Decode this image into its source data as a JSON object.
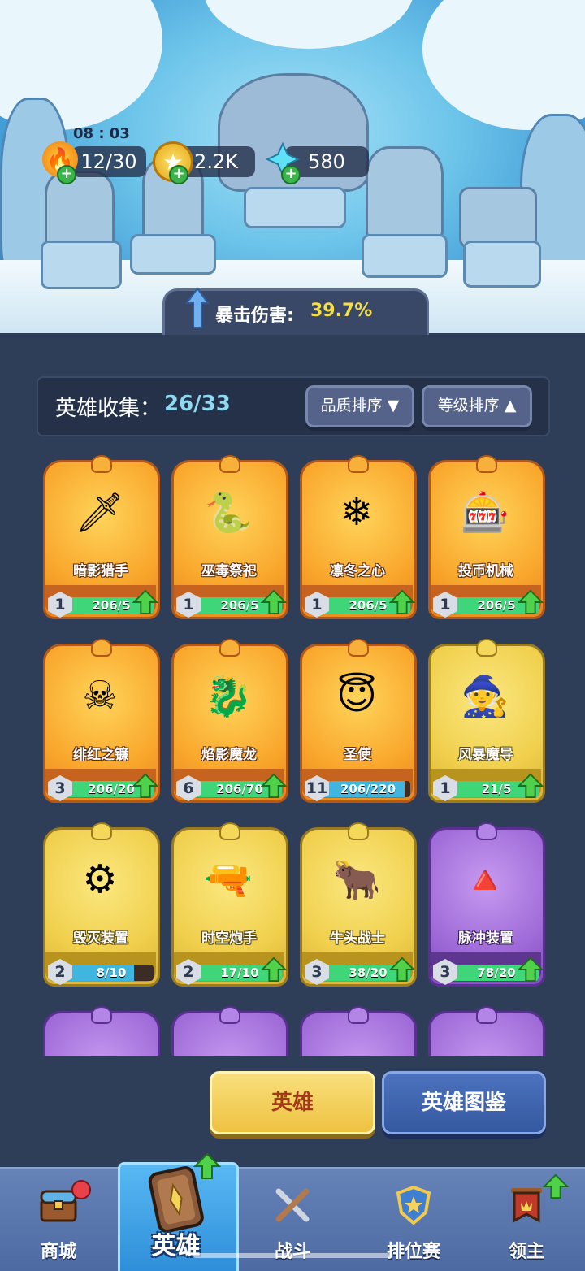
{
  "status": {
    "time": "08 : 03"
  },
  "resources": [
    {
      "name": "energy",
      "icon": "fire-icon",
      "value": "12/30"
    },
    {
      "name": "gold",
      "icon": "star-coin-icon",
      "value": "2.2K"
    },
    {
      "name": "diamond",
      "icon": "crystal-icon",
      "value": "580"
    }
  ],
  "buff": {
    "label": "暴击伤害:",
    "value": "39.7%"
  },
  "collection": {
    "label": "英雄收集：",
    "count": "26/33"
  },
  "sort": {
    "quality": "品质排序 ▼",
    "level": "等级排序 ▲"
  },
  "heroes": [
    {
      "name": "暗影猎手",
      "level": "1",
      "progress": "206/5",
      "fill": 1.0,
      "rarity": "orange",
      "icon": "hooded-hunter-icon",
      "upgradable": true
    },
    {
      "name": "巫毒祭祀",
      "level": "1",
      "progress": "206/5",
      "fill": 1.0,
      "rarity": "orange",
      "icon": "voodoo-priest-icon",
      "upgradable": true
    },
    {
      "name": "凛冬之心",
      "level": "1",
      "progress": "206/5",
      "fill": 1.0,
      "rarity": "orange",
      "icon": "ice-queen-icon",
      "upgradable": true
    },
    {
      "name": "投币机械",
      "level": "1",
      "progress": "206/5",
      "fill": 1.0,
      "rarity": "orange",
      "icon": "coin-robot-icon",
      "upgradable": true
    },
    {
      "name": "绯红之镰",
      "level": "3",
      "progress": "206/20",
      "fill": 1.0,
      "rarity": "orange",
      "icon": "scythe-demon-icon",
      "upgradable": true
    },
    {
      "name": "焰影魔龙",
      "level": "6",
      "progress": "206/70",
      "fill": 1.0,
      "rarity": "orange",
      "icon": "dragon-icon",
      "upgradable": true
    },
    {
      "name": "圣使",
      "level": "11",
      "progress": "206/220",
      "fill": 0.94,
      "rarity": "orange",
      "icon": "angel-icon",
      "upgradable": false
    },
    {
      "name": "风暴魔导",
      "level": "1",
      "progress": "21/5",
      "fill": 1.0,
      "rarity": "yellow",
      "icon": "wizard-icon",
      "upgradable": true
    },
    {
      "name": "毁灭装置",
      "level": "2",
      "progress": "8/10",
      "fill": 0.8,
      "rarity": "yellow",
      "icon": "cannon-device-icon",
      "upgradable": false
    },
    {
      "name": "时空炮手",
      "level": "2",
      "progress": "17/10",
      "fill": 1.0,
      "rarity": "yellow",
      "icon": "gunner-icon",
      "upgradable": true
    },
    {
      "name": "牛头战士",
      "level": "3",
      "progress": "38/20",
      "fill": 1.0,
      "rarity": "yellow",
      "icon": "minotaur-icon",
      "upgradable": true
    },
    {
      "name": "脉冲装置",
      "level": "3",
      "progress": "78/20",
      "fill": 1.0,
      "rarity": "purple",
      "icon": "pulse-device-icon",
      "upgradable": true
    }
  ],
  "buttons": {
    "hero": "英雄",
    "book": "英雄图鉴"
  },
  "nav": {
    "shop": "商城",
    "hero": "英雄",
    "battle": "战斗",
    "rank": "排位赛",
    "lord": "领主"
  },
  "colors": {
    "bar_green": "#3fd67a",
    "bar_blue": "#3fb6e0",
    "accent_yellow": "#f6de4b"
  }
}
